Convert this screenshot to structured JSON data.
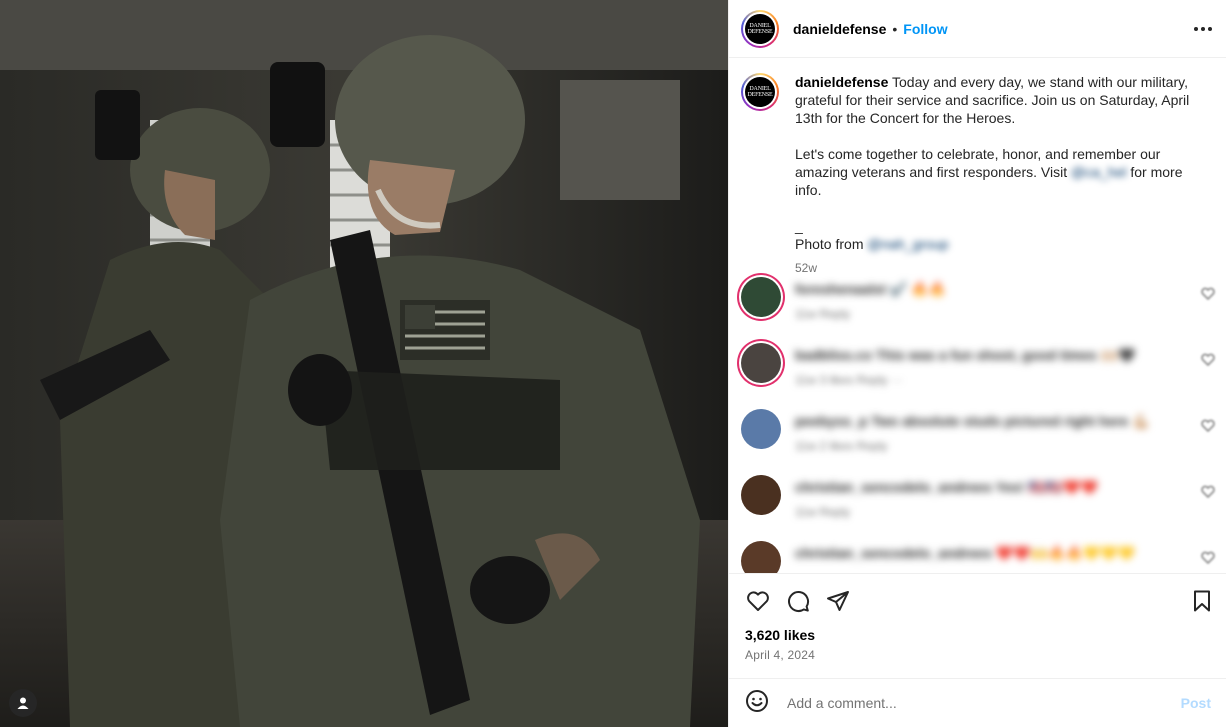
{
  "post": {
    "username": "danieldefense",
    "separator": "•",
    "follow_label": "Follow",
    "avatar_text": "DANIEL DEFENSE"
  },
  "caption": {
    "username": "danieldefense",
    "text_1": "Today and every day, we stand with our military, grateful for their service and sacrifice. Join us on Saturday, April 13th for the Concert for the Heroes.",
    "text_2a": "Let's come together to celebrate, honor, and remember our amazing veterans and first responders. Visit",
    "link_1": "@ca_hel",
    "text_2b": "for more info.",
    "dash": "_",
    "photo_prefix": "Photo from",
    "link_2": "@nah_group",
    "time": "52w"
  },
  "comments": [
    {
      "text": "foreshenaalst ✔️ 🔥🔥",
      "meta": "11w  Reply",
      "avatar_color": "#2f4a35"
    },
    {
      "text": "badbliss.co This was a fun shoot, good times 🙌🏼🖤",
      "meta": "11w  3 likes  Reply  ···",
      "avatar_color": "#4a4440"
    },
    {
      "text": "peebyss_p Two absolute studs pictured right here 💪🏼",
      "meta": "11w  2 likes  Reply",
      "avatar_color": "#5a7aa8"
    },
    {
      "text": "christian_sencodelo_andrees Yes! 🇺🇸🇺🇸❤️❤️",
      "meta": "11w  Reply",
      "avatar_color": "#4a3020"
    },
    {
      "text": "christian_sencodelo_andrees ❤️❤️🙌🔥🔥💛💛💛",
      "meta": "",
      "avatar_color": "#5a3a28"
    }
  ],
  "stats": {
    "likes": "3,620 likes",
    "date": "April 4, 2024"
  },
  "composer": {
    "placeholder": "Add a comment...",
    "post_label": "Post"
  },
  "icons": {
    "like": "heart-icon",
    "comment": "comment-icon",
    "share": "share-icon",
    "save": "bookmark-icon",
    "emoji": "emoji-icon",
    "more": "more-options-icon",
    "user": "person-icon"
  },
  "colors": {
    "link": "#0095f6",
    "secondary_text": "#737373",
    "post_disabled": "#b3dbff"
  }
}
